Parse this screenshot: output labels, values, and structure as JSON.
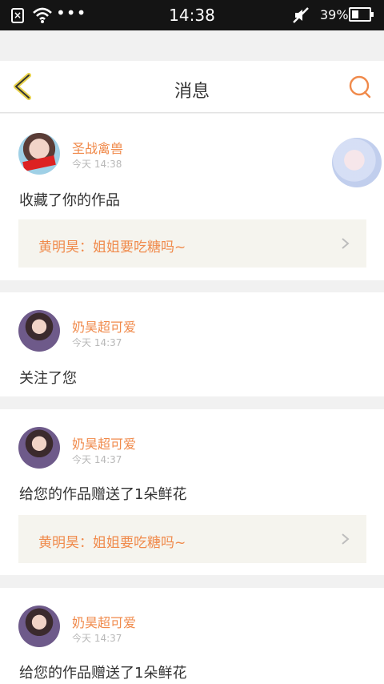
{
  "status_bar": {
    "time": "14:38",
    "battery": "39%",
    "sim_icon": "sim-missing-icon",
    "wifi_icon": "wifi-icon",
    "mute_icon": "mute-icon"
  },
  "navbar": {
    "title": "消息",
    "back_icon": "chevron-left-icon",
    "search_icon": "search-icon",
    "accent_color": "#f08a4b"
  },
  "notifications": [
    {
      "user": "圣战禽兽",
      "time": "今天 14:38",
      "message": "收藏了你的作品",
      "quote": "黄明昊：姐姐要吃糖吗~"
    },
    {
      "user": "奶昊超可爱",
      "time": "今天 14:37",
      "message": "关注了您"
    },
    {
      "user": "奶昊超可爱",
      "time": "今天 14:37",
      "message": "给您的作品赠送了1朵鲜花",
      "quote": "黄明昊：姐姐要吃糖吗~"
    },
    {
      "user": "奶昊超可爱",
      "time": "今天 14:37",
      "message": "给您的作品赠送了1朵鲜花"
    }
  ]
}
